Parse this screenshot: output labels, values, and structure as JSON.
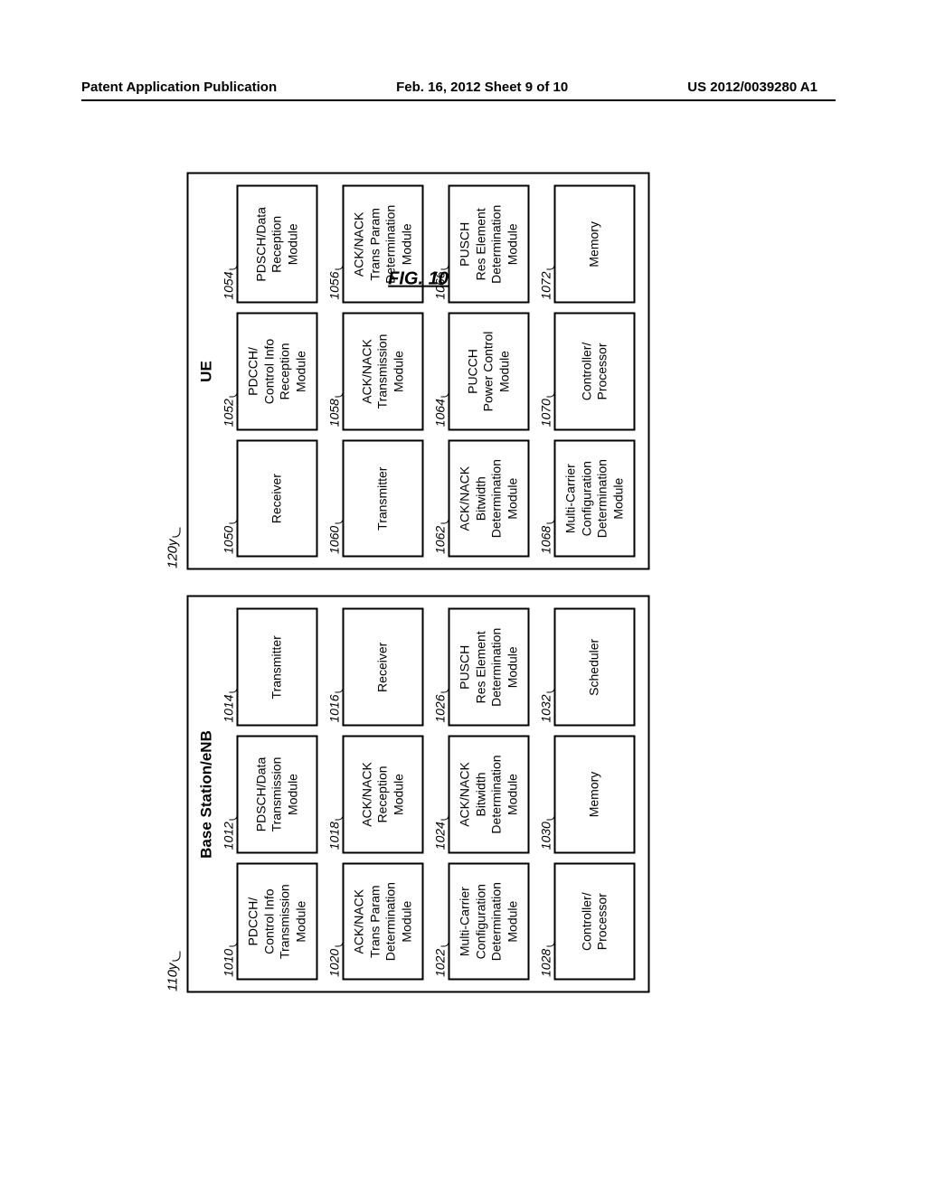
{
  "header": {
    "left": "Patent Application Publication",
    "center": "Feb. 16, 2012  Sheet 9 of 10",
    "right": "US 2012/0039280 A1"
  },
  "figure_caption": "FIG. 10",
  "base_station": {
    "panel_id": "110y",
    "title": "Base Station/eNB",
    "rows": [
      [
        {
          "ref": "1010",
          "lines": [
            "PDCCH/",
            "Control Info",
            "Transmission",
            "Module"
          ]
        },
        {
          "ref": "1012",
          "lines": [
            "PDSCH/Data",
            "Transmission",
            "Module"
          ]
        },
        {
          "ref": "1014",
          "lines": [
            "Transmitter"
          ]
        }
      ],
      [
        {
          "ref": "1020",
          "lines": [
            "ACK/NACK",
            "Trans Param",
            "Determination",
            "Module"
          ]
        },
        {
          "ref": "1018",
          "lines": [
            "ACK/NACK",
            "Reception",
            "Module"
          ]
        },
        {
          "ref": "1016",
          "lines": [
            "Receiver"
          ]
        }
      ],
      [
        {
          "ref": "1022",
          "lines": [
            "Multi-Carrier",
            "Configuration",
            "Determination",
            "Module"
          ]
        },
        {
          "ref": "1024",
          "lines": [
            "ACK/NACK",
            "Bitwidth",
            "Determination",
            "Module"
          ]
        },
        {
          "ref": "1026",
          "lines": [
            "PUSCH",
            "Res Element",
            "Determination",
            "Module"
          ]
        }
      ],
      [
        {
          "ref": "1028",
          "lines": [
            "Controller/",
            "Processor"
          ]
        },
        {
          "ref": "1030",
          "lines": [
            "Memory"
          ]
        },
        {
          "ref": "1032",
          "lines": [
            "Scheduler"
          ]
        }
      ]
    ]
  },
  "ue": {
    "panel_id": "120y",
    "title": "UE",
    "rows": [
      [
        {
          "ref": "1050",
          "lines": [
            "Receiver"
          ]
        },
        {
          "ref": "1052",
          "lines": [
            "PDCCH/",
            "Control Info",
            "Reception",
            "Module"
          ]
        },
        {
          "ref": "1054",
          "lines": [
            "PDSCH/Data",
            "Reception",
            "Module"
          ]
        }
      ],
      [
        {
          "ref": "1060",
          "lines": [
            "Transmitter"
          ]
        },
        {
          "ref": "1058",
          "lines": [
            "ACK/NACK",
            "Transmission",
            "Module"
          ]
        },
        {
          "ref": "1056",
          "lines": [
            "ACK/NACK",
            "Trans Param",
            "Determination",
            "Module"
          ]
        }
      ],
      [
        {
          "ref": "1062",
          "lines": [
            "ACK/NACK",
            "Bitwidth",
            "Determination",
            "Module"
          ]
        },
        {
          "ref": "1064",
          "lines": [
            "PUCCH",
            "Power Control",
            "Module"
          ]
        },
        {
          "ref": "1066",
          "lines": [
            "PUSCH",
            "Res Element",
            "Determination",
            "Module"
          ]
        }
      ],
      [
        {
          "ref": "1068",
          "lines": [
            "Multi-Carrier",
            "Configuration",
            "Determination",
            "Module"
          ]
        },
        {
          "ref": "1070",
          "lines": [
            "Controller/",
            "Processor"
          ]
        },
        {
          "ref": "1072",
          "lines": [
            "Memory"
          ]
        }
      ]
    ]
  }
}
